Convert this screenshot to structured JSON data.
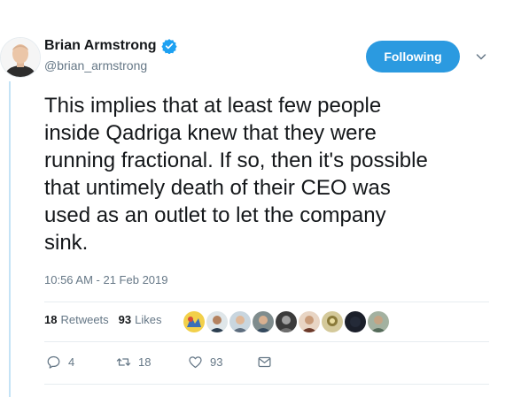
{
  "user": {
    "name": "Brian Armstrong",
    "handle": "@brian_armstrong",
    "verified": true
  },
  "follow_button": {
    "label": "Following"
  },
  "tweet": {
    "text": "This implies that at least few people\ninside Qadriga knew that they were\nrunning fractional. If so, then it's possible\nthat untimely death of their CEO was\nused as an outlet to let the company\nsink.",
    "timestamp": "10:56 AM - 21 Feb 2019"
  },
  "stats": {
    "retweets_count": "18",
    "retweets_label": "Retweets",
    "likes_count": "93",
    "likes_label": "Likes"
  },
  "actions": {
    "reply_count": "4",
    "retweet_count": "18",
    "like_count": "93"
  },
  "colors": {
    "accent": "#2b9ae0",
    "thread_line": "#c4e3f6",
    "muted_text": "#657786",
    "divider": "#e6ecf0"
  },
  "icons": {
    "verified": "verified-badge-icon",
    "caret": "chevron-down-icon",
    "reply": "reply-icon",
    "retweet": "retweet-icon",
    "like": "heart-icon",
    "dm": "envelope-icon"
  }
}
